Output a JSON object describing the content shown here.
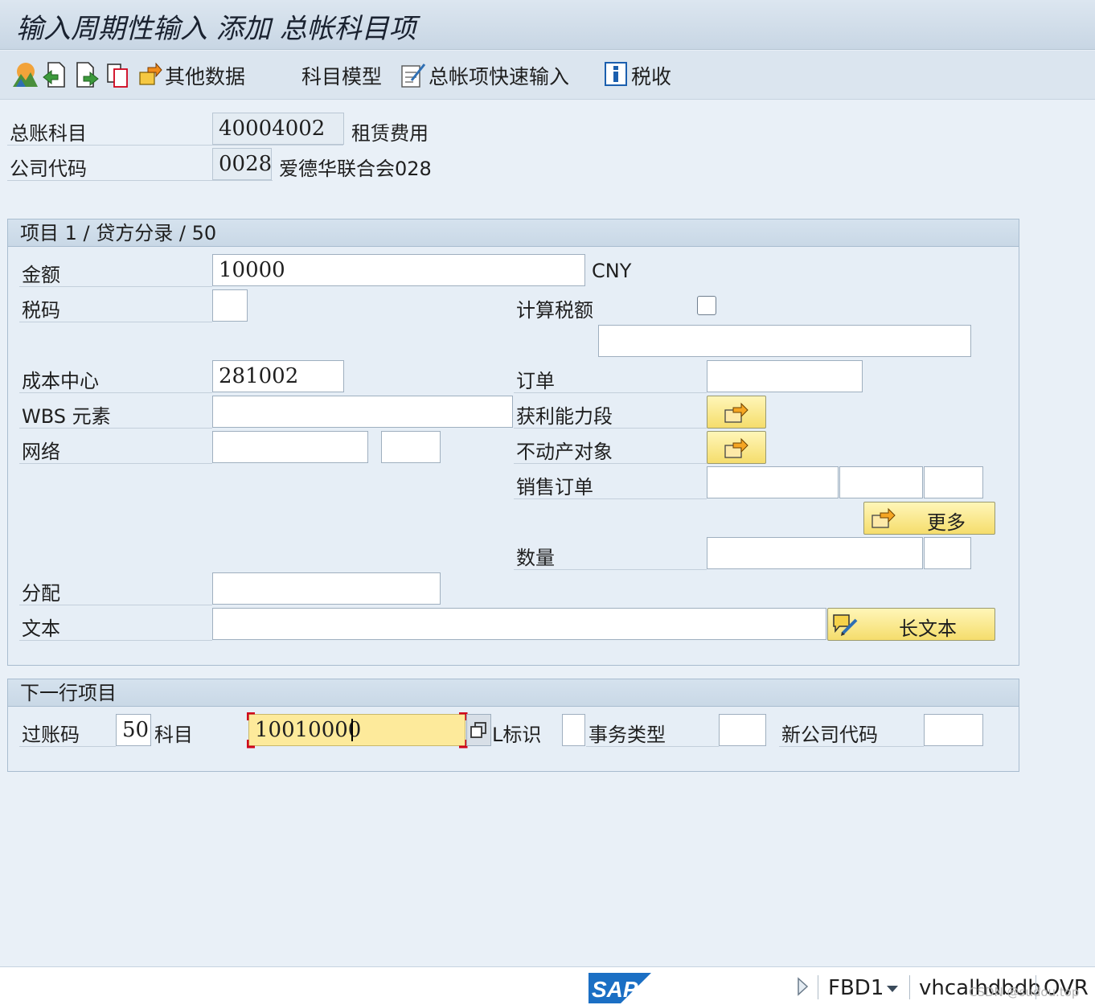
{
  "title": "输入周期性输入 添加 总帐科目项",
  "toolbar": {
    "other_data": "其他数据",
    "account_model": "科目模型",
    "gl_fast_entry": "总帐项快速输入",
    "tax": "税收"
  },
  "header": {
    "gl_account_label": "总账科目",
    "gl_account_value": "40004002",
    "gl_account_desc": "租赁费用",
    "company_code_label": "公司代码",
    "company_code_value": "0028",
    "company_code_desc": "爱德华联合会028"
  },
  "item": {
    "heading": "项目 1 / 贷方分录 / 50",
    "amount_label": "金额",
    "amount_value": "10000",
    "currency": "CNY",
    "tax_code_label": "税码",
    "tax_code_value": "",
    "calc_tax_label": "计算税额",
    "calc_tax_checked": false,
    "tax_extra_value": "",
    "cost_center_label": "成本中心",
    "cost_center_value": "281002",
    "order_label": "订单",
    "order_value": "",
    "wbs_label": "WBS 元素",
    "wbs_value": "",
    "profit_segment_label": "获利能力段",
    "network_label": "网络",
    "network_value": "",
    "network_op_value": "",
    "real_estate_label": "不动产对象",
    "sales_order_label": "销售订单",
    "sales_order_value": "",
    "sales_order_item": "",
    "sales_order_sched": "",
    "more_label": "更多",
    "quantity_label": "数量",
    "quantity_value": "",
    "quantity_unit": "",
    "assignment_label": "分配",
    "assignment_value": "",
    "text_label": "文本",
    "text_value": "",
    "long_text_label": "长文本"
  },
  "next_item": {
    "heading": "下一行项目",
    "posting_key_label": "过账码",
    "posting_key_value": "50",
    "account_label": "科目",
    "account_value": "10010000",
    "sp_gl_label": "L标识",
    "sp_gl_value": "",
    "trans_type_label": "事务类型",
    "trans_type_value": "",
    "new_cocode_label": "新公司代码",
    "new_cocode_value": ""
  },
  "status": {
    "sap_logo": "SAP",
    "tcode": "FBD1",
    "server": "vhcalhdbdb",
    "mode": "OVR",
    "watermark": "CSDN @sudou.top"
  },
  "colors": {
    "background": "#e9f0f7",
    "yellow_button": "#f5dd6c",
    "focus_field": "#fdea9b",
    "focus_corner": "#d0021b",
    "sap_blue": "#1b6fc4"
  }
}
